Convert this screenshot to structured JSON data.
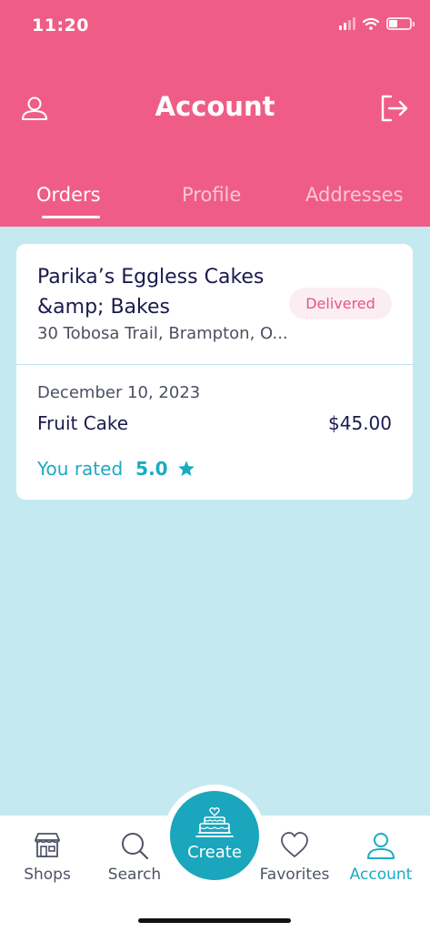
{
  "status_bar": {
    "time": "11:20"
  },
  "header": {
    "title": "Account",
    "profile_icon": "person-outline-icon",
    "logout_icon": "logout-icon"
  },
  "tabs": [
    {
      "label": "Orders",
      "active": true
    },
    {
      "label": "Profile",
      "active": false
    },
    {
      "label": "Addresses",
      "active": false
    }
  ],
  "order": {
    "shop_name": "Parika’s Eggless Cakes &amp; Bakes",
    "address": "30 Tobosa Trail, Brampton, O...",
    "status": "Delivered",
    "date": "December 10, 2023",
    "item": "Fruit Cake",
    "price": "$45.00",
    "rated_label": "You rated",
    "rating": "5.0"
  },
  "bottom_nav": {
    "shops": "Shops",
    "search": "Search",
    "create": "Create",
    "favorites": "Favorites",
    "account": "Account"
  },
  "colors": {
    "header_pink": "#ef5d87",
    "background": "#c4e9f0",
    "accent_teal": "#1aa6bd",
    "text_navy": "#1a1a4e"
  }
}
